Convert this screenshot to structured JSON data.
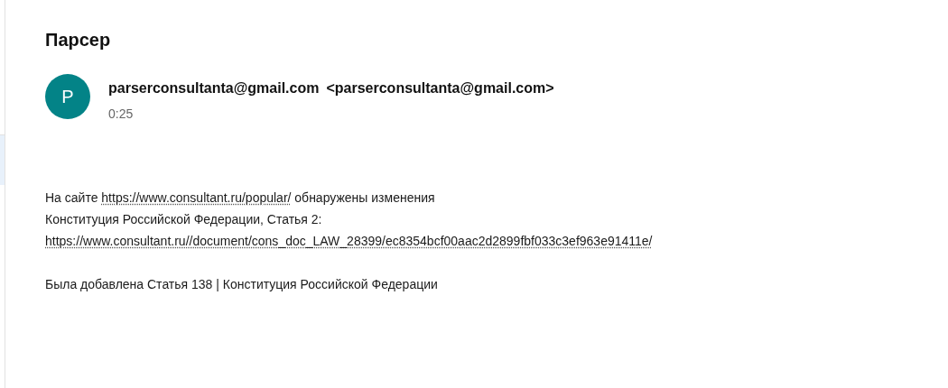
{
  "subject": "Парсер",
  "sender": {
    "initial": "P",
    "name": "parserconsultanta@gmail.com",
    "address": "<parserconsultanta@gmail.com>",
    "time": "0:25"
  },
  "body": [
    [
      [
        {
          "kind": "text",
          "text": "На сайте "
        },
        {
          "kind": "link",
          "text": "https://www.consultant.ru/popular/"
        },
        {
          "kind": "text",
          "text": " обнаружены изменения"
        }
      ],
      [
        {
          "kind": "text",
          "text": "Конституция Российской Федерации, Статья 2:"
        }
      ],
      [
        {
          "kind": "link",
          "text": "https://www.consultant.ru//document/cons_doc_LAW_28399/ec8354bcf00aac2d2899fbf033c3ef963e91411e/"
        }
      ]
    ],
    [
      [
        {
          "kind": "text",
          "text": "Была добавлена Статья 138 | Конституция Российской Федерации"
        }
      ]
    ]
  ]
}
